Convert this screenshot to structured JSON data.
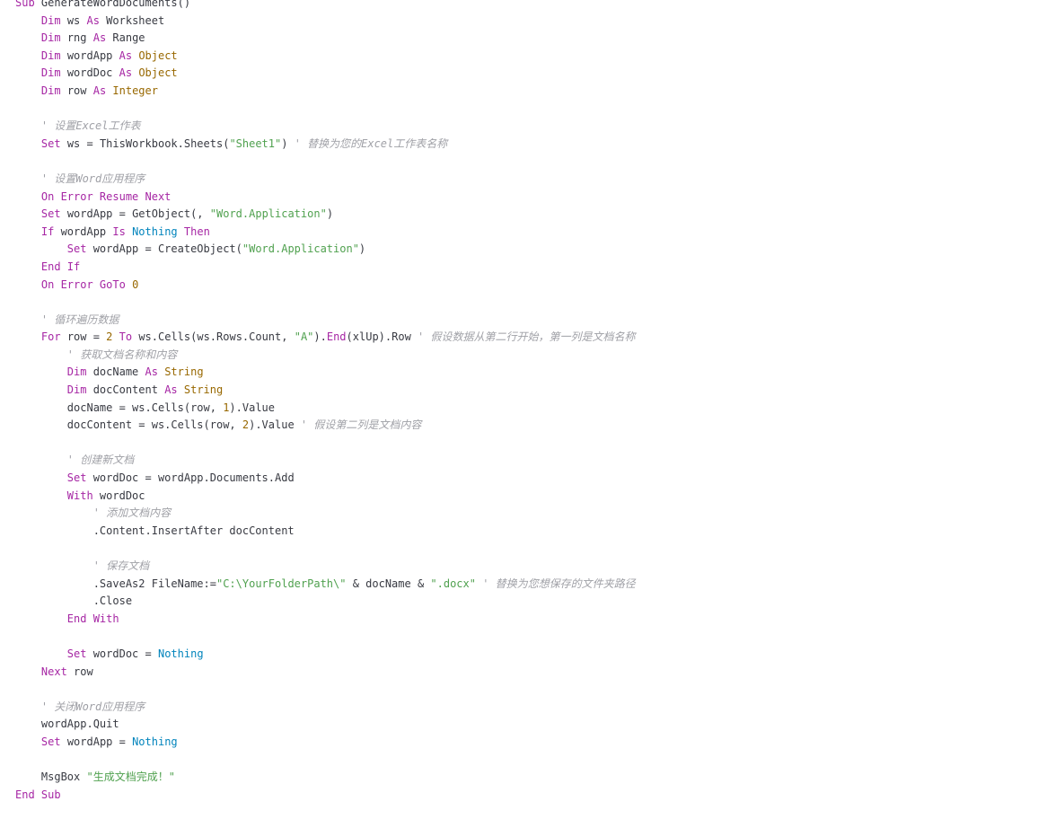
{
  "editor": {
    "language": "VBA",
    "colors": {
      "background": "#ffffff",
      "keyword": "#a626a4",
      "type": "#986801",
      "string": "#50a14f",
      "number": "#986801",
      "comment": "#a0a1a7",
      "literal": "#0184bc",
      "plain": "#383a42"
    },
    "lines": [
      [
        [
          "kw",
          "Sub"
        ],
        [
          "pl",
          " GenerateWordDocuments()"
        ]
      ],
      [
        [
          "pl",
          "    "
        ],
        [
          "kw",
          "Dim"
        ],
        [
          "pl",
          " ws "
        ],
        [
          "kw",
          "As"
        ],
        [
          "pl",
          " Worksheet"
        ]
      ],
      [
        [
          "pl",
          "    "
        ],
        [
          "kw",
          "Dim"
        ],
        [
          "pl",
          " rng "
        ],
        [
          "kw",
          "As"
        ],
        [
          "pl",
          " Range"
        ]
      ],
      [
        [
          "pl",
          "    "
        ],
        [
          "kw",
          "Dim"
        ],
        [
          "pl",
          " wordApp "
        ],
        [
          "kw",
          "As"
        ],
        [
          "pl",
          " "
        ],
        [
          "tp",
          "Object"
        ]
      ],
      [
        [
          "pl",
          "    "
        ],
        [
          "kw",
          "Dim"
        ],
        [
          "pl",
          " wordDoc "
        ],
        [
          "kw",
          "As"
        ],
        [
          "pl",
          " "
        ],
        [
          "tp",
          "Object"
        ]
      ],
      [
        [
          "pl",
          "    "
        ],
        [
          "kw",
          "Dim"
        ],
        [
          "pl",
          " row "
        ],
        [
          "kw",
          "As"
        ],
        [
          "pl",
          " "
        ],
        [
          "tp",
          "Integer"
        ]
      ],
      [],
      [
        [
          "pl",
          "    "
        ],
        [
          "cm",
          "' 设置Excel工作表"
        ]
      ],
      [
        [
          "pl",
          "    "
        ],
        [
          "kw",
          "Set"
        ],
        [
          "pl",
          " ws = ThisWorkbook.Sheets("
        ],
        [
          "str",
          "\"Sheet1\""
        ],
        [
          "pl",
          ") "
        ],
        [
          "cm",
          "' 替换为您的Excel工作表名称"
        ]
      ],
      [],
      [
        [
          "pl",
          "    "
        ],
        [
          "cm",
          "' 设置Word应用程序"
        ]
      ],
      [
        [
          "pl",
          "    "
        ],
        [
          "kw",
          "On Error Resume Next"
        ]
      ],
      [
        [
          "pl",
          "    "
        ],
        [
          "kw",
          "Set"
        ],
        [
          "pl",
          " wordApp = GetObject(, "
        ],
        [
          "str",
          "\"Word.Application\""
        ],
        [
          "pl",
          ")"
        ]
      ],
      [
        [
          "pl",
          "    "
        ],
        [
          "kw",
          "If"
        ],
        [
          "pl",
          " wordApp "
        ],
        [
          "kw",
          "Is"
        ],
        [
          "pl",
          " "
        ],
        [
          "lit",
          "Nothing"
        ],
        [
          "pl",
          " "
        ],
        [
          "kw",
          "Then"
        ]
      ],
      [
        [
          "pl",
          "        "
        ],
        [
          "kw",
          "Set"
        ],
        [
          "pl",
          " wordApp = CreateObject("
        ],
        [
          "str",
          "\"Word.Application\""
        ],
        [
          "pl",
          ")"
        ]
      ],
      [
        [
          "pl",
          "    "
        ],
        [
          "kw",
          "End If"
        ]
      ],
      [
        [
          "pl",
          "    "
        ],
        [
          "kw",
          "On Error GoTo"
        ],
        [
          "pl",
          " "
        ],
        [
          "num",
          "0"
        ]
      ],
      [],
      [
        [
          "pl",
          "    "
        ],
        [
          "cm",
          "' 循环遍历数据"
        ]
      ],
      [
        [
          "pl",
          "    "
        ],
        [
          "kw",
          "For"
        ],
        [
          "pl",
          " row = "
        ],
        [
          "num",
          "2"
        ],
        [
          "pl",
          " "
        ],
        [
          "kw",
          "To"
        ],
        [
          "pl",
          " ws.Cells(ws.Rows.Count, "
        ],
        [
          "str",
          "\"A\""
        ],
        [
          "pl",
          ")."
        ],
        [
          "kw",
          "End"
        ],
        [
          "pl",
          "(xlUp).Row "
        ],
        [
          "cm",
          "' 假设数据从第二行开始，第一列是文档名称"
        ]
      ],
      [
        [
          "pl",
          "        "
        ],
        [
          "cm",
          "' 获取文档名称和内容"
        ]
      ],
      [
        [
          "pl",
          "        "
        ],
        [
          "kw",
          "Dim"
        ],
        [
          "pl",
          " docName "
        ],
        [
          "kw",
          "As"
        ],
        [
          "pl",
          " "
        ],
        [
          "tp",
          "String"
        ]
      ],
      [
        [
          "pl",
          "        "
        ],
        [
          "kw",
          "Dim"
        ],
        [
          "pl",
          " docContent "
        ],
        [
          "kw",
          "As"
        ],
        [
          "pl",
          " "
        ],
        [
          "tp",
          "String"
        ]
      ],
      [
        [
          "pl",
          "        docName = ws.Cells(row, "
        ],
        [
          "num",
          "1"
        ],
        [
          "pl",
          ").Value"
        ]
      ],
      [
        [
          "pl",
          "        docContent = ws.Cells(row, "
        ],
        [
          "num",
          "2"
        ],
        [
          "pl",
          ").Value "
        ],
        [
          "cm",
          "' 假设第二列是文档内容"
        ]
      ],
      [],
      [
        [
          "pl",
          "        "
        ],
        [
          "cm",
          "' 创建新文档"
        ]
      ],
      [
        [
          "pl",
          "        "
        ],
        [
          "kw",
          "Set"
        ],
        [
          "pl",
          " wordDoc = wordApp.Documents.Add"
        ]
      ],
      [
        [
          "pl",
          "        "
        ],
        [
          "kw",
          "With"
        ],
        [
          "pl",
          " wordDoc"
        ]
      ],
      [
        [
          "pl",
          "            "
        ],
        [
          "cm",
          "' 添加文档内容"
        ]
      ],
      [
        [
          "pl",
          "            .Content.InsertAfter docContent"
        ]
      ],
      [],
      [
        [
          "pl",
          "            "
        ],
        [
          "cm",
          "' 保存文档"
        ]
      ],
      [
        [
          "pl",
          "            .SaveAs2 FileName:="
        ],
        [
          "str",
          "\"C:\\YourFolderPath\\\""
        ],
        [
          "pl",
          " & docName & "
        ],
        [
          "str",
          "\".docx\""
        ],
        [
          "pl",
          " "
        ],
        [
          "cm",
          "' 替换为您想保存的文件夹路径"
        ]
      ],
      [
        [
          "pl",
          "            .Close"
        ]
      ],
      [
        [
          "pl",
          "        "
        ],
        [
          "kw",
          "End With"
        ]
      ],
      [],
      [
        [
          "pl",
          "        "
        ],
        [
          "kw",
          "Set"
        ],
        [
          "pl",
          " wordDoc = "
        ],
        [
          "lit",
          "Nothing"
        ]
      ],
      [
        [
          "pl",
          "    "
        ],
        [
          "kw",
          "Next"
        ],
        [
          "pl",
          " row"
        ]
      ],
      [],
      [
        [
          "pl",
          "    "
        ],
        [
          "cm",
          "' 关闭Word应用程序"
        ]
      ],
      [
        [
          "pl",
          "    wordApp.Quit"
        ]
      ],
      [
        [
          "pl",
          "    "
        ],
        [
          "kw",
          "Set"
        ],
        [
          "pl",
          " wordApp = "
        ],
        [
          "lit",
          "Nothing"
        ]
      ],
      [],
      [
        [
          "pl",
          "    MsgBox "
        ],
        [
          "str",
          "\"生成文档完成！\""
        ]
      ],
      [
        [
          "kw",
          "End Sub"
        ]
      ]
    ]
  }
}
